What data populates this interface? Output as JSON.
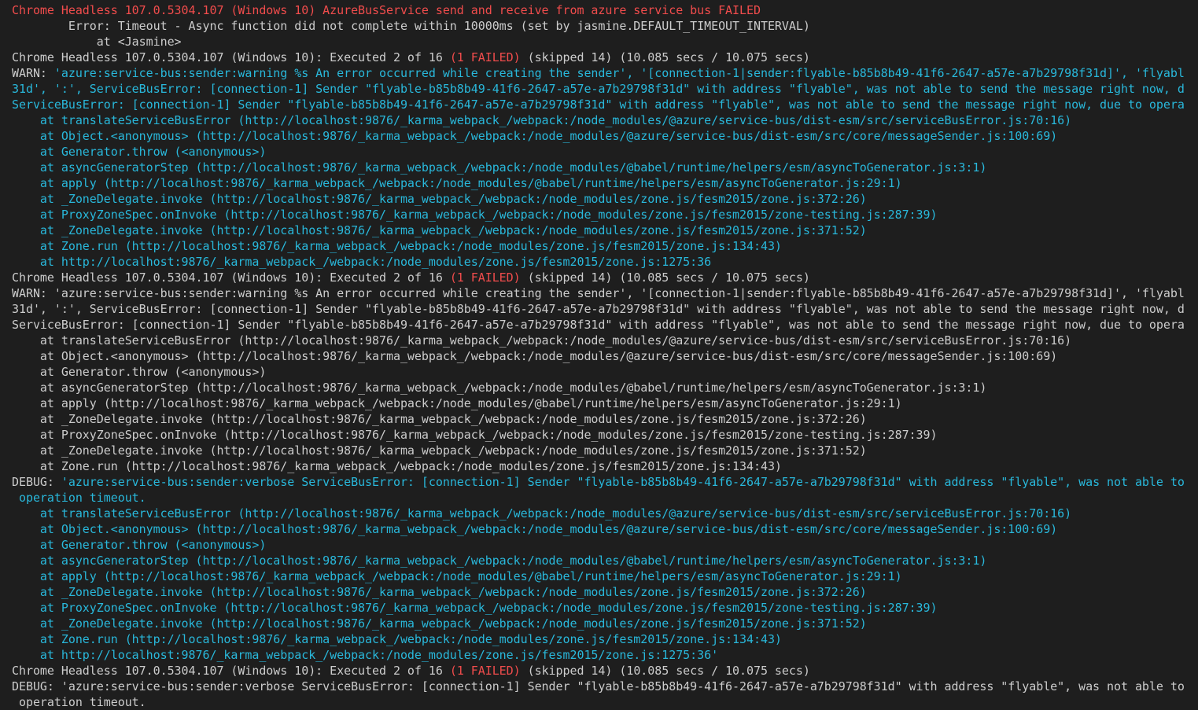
{
  "colors": {
    "background": "#1e1e1e",
    "default": "#cccccc",
    "red": "#f14c4c",
    "blue": "#29b8db"
  },
  "terminal": {
    "lines": [
      {
        "segments": [
          {
            "text": "Chrome Headless 107.0.5304.107 (Windows 10) AzureBusService send and receive from azure service bus FAILED",
            "color": "red"
          }
        ]
      },
      {
        "segments": [
          {
            "text": "        Error: Timeout - Async function did not complete within 10000ms (set by jasmine.DEFAULT_TIMEOUT_INTERVAL)",
            "color": "default"
          }
        ]
      },
      {
        "segments": [
          {
            "text": "            at <Jasmine>",
            "color": "default"
          }
        ]
      },
      {
        "segments": [
          {
            "text": "Chrome Headless 107.0.5304.107 (Windows 10): Executed 2 of 16 ",
            "color": "default"
          },
          {
            "text": "(1 FAILED)",
            "color": "red"
          },
          {
            "text": " (skipped 14) (10.085 secs / 10.075 secs)",
            "color": "default"
          }
        ]
      },
      {
        "segments": [
          {
            "text": "WARN: ",
            "color": "default"
          },
          {
            "text": "'azure:service-bus:sender:warning %s An error occurred while creating the sender', '[connection-1|sender:flyable-b85b8b49-41f6-2647-a57e-a7b29798f31d]', 'flyabl",
            "color": "blue"
          }
        ]
      },
      {
        "segments": [
          {
            "text": "31d', ':', ServiceBusError: [connection-1] Sender \"flyable-b85b8b49-41f6-2647-a57e-a7b29798f31d\" with address \"flyable\", was not able to send the message right now, d",
            "color": "blue"
          }
        ]
      },
      {
        "segments": [
          {
            "text": "ServiceBusError: [connection-1] Sender \"flyable-b85b8b49-41f6-2647-a57e-a7b29798f31d\" with address \"flyable\", was not able to send the message right now, due to opera",
            "color": "blue"
          }
        ]
      },
      {
        "segments": [
          {
            "text": "    at translateServiceBusError (http://localhost:9876/_karma_webpack_/webpack:/node_modules/@azure/service-bus/dist-esm/src/serviceBusError.js:70:16)",
            "color": "blue"
          }
        ]
      },
      {
        "segments": [
          {
            "text": "    at Object.<anonymous> (http://localhost:9876/_karma_webpack_/webpack:/node_modules/@azure/service-bus/dist-esm/src/core/messageSender.js:100:69)",
            "color": "blue"
          }
        ]
      },
      {
        "segments": [
          {
            "text": "    at Generator.throw (<anonymous>)",
            "color": "blue"
          }
        ]
      },
      {
        "segments": [
          {
            "text": "    at asyncGeneratorStep (http://localhost:9876/_karma_webpack_/webpack:/node_modules/@babel/runtime/helpers/esm/asyncToGenerator.js:3:1)",
            "color": "blue"
          }
        ]
      },
      {
        "segments": [
          {
            "text": "    at apply (http://localhost:9876/_karma_webpack_/webpack:/node_modules/@babel/runtime/helpers/esm/asyncToGenerator.js:29:1)",
            "color": "blue"
          }
        ]
      },
      {
        "segments": [
          {
            "text": "    at _ZoneDelegate.invoke (http://localhost:9876/_karma_webpack_/webpack:/node_modules/zone.js/fesm2015/zone.js:372:26)",
            "color": "blue"
          }
        ]
      },
      {
        "segments": [
          {
            "text": "    at ProxyZoneSpec.onInvoke (http://localhost:9876/_karma_webpack_/webpack:/node_modules/zone.js/fesm2015/zone-testing.js:287:39)",
            "color": "blue"
          }
        ]
      },
      {
        "segments": [
          {
            "text": "    at _ZoneDelegate.invoke (http://localhost:9876/_karma_webpack_/webpack:/node_modules/zone.js/fesm2015/zone.js:371:52)",
            "color": "blue"
          }
        ]
      },
      {
        "segments": [
          {
            "text": "    at Zone.run (http://localhost:9876/_karma_webpack_/webpack:/node_modules/zone.js/fesm2015/zone.js:134:43)",
            "color": "blue"
          }
        ]
      },
      {
        "segments": [
          {
            "text": "    at http://localhost:9876/_karma_webpack_/webpack:/node_modules/zone.js/fesm2015/zone.js:1275:36",
            "color": "blue"
          }
        ]
      },
      {
        "segments": [
          {
            "text": "Chrome Headless 107.0.5304.107 (Windows 10): Executed 2 of 16 ",
            "color": "default"
          },
          {
            "text": "(1 FAILED)",
            "color": "red"
          },
          {
            "text": " (skipped 14) (10.085 secs / 10.075 secs)",
            "color": "default"
          }
        ]
      },
      {
        "segments": [
          {
            "text": "WARN: 'azure:service-bus:sender:warning %s An error occurred while creating the sender', '[connection-1|sender:flyable-b85b8b49-41f6-2647-a57e-a7b29798f31d]', 'flyabl",
            "color": "default"
          }
        ]
      },
      {
        "segments": [
          {
            "text": "31d', ':', ServiceBusError: [connection-1] Sender \"flyable-b85b8b49-41f6-2647-a57e-a7b29798f31d\" with address \"flyable\", was not able to send the message right now, d",
            "color": "default"
          }
        ]
      },
      {
        "segments": [
          {
            "text": "ServiceBusError: [connection-1] Sender \"flyable-b85b8b49-41f6-2647-a57e-a7b29798f31d\" with address \"flyable\", was not able to send the message right now, due to opera",
            "color": "default"
          }
        ]
      },
      {
        "segments": [
          {
            "text": "    at translateServiceBusError (http://localhost:9876/_karma_webpack_/webpack:/node_modules/@azure/service-bus/dist-esm/src/serviceBusError.js:70:16)",
            "color": "default"
          }
        ]
      },
      {
        "segments": [
          {
            "text": "    at Object.<anonymous> (http://localhost:9876/_karma_webpack_/webpack:/node_modules/@azure/service-bus/dist-esm/src/core/messageSender.js:100:69)",
            "color": "default"
          }
        ]
      },
      {
        "segments": [
          {
            "text": "    at Generator.throw (<anonymous>)",
            "color": "default"
          }
        ]
      },
      {
        "segments": [
          {
            "text": "    at asyncGeneratorStep (http://localhost:9876/_karma_webpack_/webpack:/node_modules/@babel/runtime/helpers/esm/asyncToGenerator.js:3:1)",
            "color": "default"
          }
        ]
      },
      {
        "segments": [
          {
            "text": "    at apply (http://localhost:9876/_karma_webpack_/webpack:/node_modules/@babel/runtime/helpers/esm/asyncToGenerator.js:29:1)",
            "color": "default"
          }
        ]
      },
      {
        "segments": [
          {
            "text": "    at _ZoneDelegate.invoke (http://localhost:9876/_karma_webpack_/webpack:/node_modules/zone.js/fesm2015/zone.js:372:26)",
            "color": "default"
          }
        ]
      },
      {
        "segments": [
          {
            "text": "    at ProxyZoneSpec.onInvoke (http://localhost:9876/_karma_webpack_/webpack:/node_modules/zone.js/fesm2015/zone-testing.js:287:39)",
            "color": "default"
          }
        ]
      },
      {
        "segments": [
          {
            "text": "    at _ZoneDelegate.invoke (http://localhost:9876/_karma_webpack_/webpack:/node_modules/zone.js/fesm2015/zone.js:371:52)",
            "color": "default"
          }
        ]
      },
      {
        "segments": [
          {
            "text": "    at Zone.run (http://localhost:9876/_karma_webpack_/webpack:/node_modules/zone.js/fesm2015/zone.js:134:43)",
            "color": "default"
          }
        ]
      },
      {
        "segments": [
          {
            "text": "DEBUG: ",
            "color": "default"
          },
          {
            "text": "'azure:service-bus:sender:verbose ServiceBusError: [connection-1] Sender \"flyable-b85b8b49-41f6-2647-a57e-a7b29798f31d\" with address \"flyable\", was not able to",
            "color": "blue"
          }
        ]
      },
      {
        "segments": [
          {
            "text": " operation timeout.",
            "color": "blue"
          }
        ]
      },
      {
        "segments": [
          {
            "text": "    at translateServiceBusError (http://localhost:9876/_karma_webpack_/webpack:/node_modules/@azure/service-bus/dist-esm/src/serviceBusError.js:70:16)",
            "color": "blue"
          }
        ]
      },
      {
        "segments": [
          {
            "text": "    at Object.<anonymous> (http://localhost:9876/_karma_webpack_/webpack:/node_modules/@azure/service-bus/dist-esm/src/core/messageSender.js:100:69)",
            "color": "blue"
          }
        ]
      },
      {
        "segments": [
          {
            "text": "    at Generator.throw (<anonymous>)",
            "color": "blue"
          }
        ]
      },
      {
        "segments": [
          {
            "text": "    at asyncGeneratorStep (http://localhost:9876/_karma_webpack_/webpack:/node_modules/@babel/runtime/helpers/esm/asyncToGenerator.js:3:1)",
            "color": "blue"
          }
        ]
      },
      {
        "segments": [
          {
            "text": "    at apply (http://localhost:9876/_karma_webpack_/webpack:/node_modules/@babel/runtime/helpers/esm/asyncToGenerator.js:29:1)",
            "color": "blue"
          }
        ]
      },
      {
        "segments": [
          {
            "text": "    at _ZoneDelegate.invoke (http://localhost:9876/_karma_webpack_/webpack:/node_modules/zone.js/fesm2015/zone.js:372:26)",
            "color": "blue"
          }
        ]
      },
      {
        "segments": [
          {
            "text": "    at ProxyZoneSpec.onInvoke (http://localhost:9876/_karma_webpack_/webpack:/node_modules/zone.js/fesm2015/zone-testing.js:287:39)",
            "color": "blue"
          }
        ]
      },
      {
        "segments": [
          {
            "text": "    at _ZoneDelegate.invoke (http://localhost:9876/_karma_webpack_/webpack:/node_modules/zone.js/fesm2015/zone.js:371:52)",
            "color": "blue"
          }
        ]
      },
      {
        "segments": [
          {
            "text": "    at Zone.run (http://localhost:9876/_karma_webpack_/webpack:/node_modules/zone.js/fesm2015/zone.js:134:43)",
            "color": "blue"
          }
        ]
      },
      {
        "segments": [
          {
            "text": "    at http://localhost:9876/_karma_webpack_/webpack:/node_modules/zone.js/fesm2015/zone.js:1275:36'",
            "color": "blue"
          }
        ]
      },
      {
        "segments": [
          {
            "text": "Chrome Headless 107.0.5304.107 (Windows 10): Executed 2 of 16 ",
            "color": "default"
          },
          {
            "text": "(1 FAILED)",
            "color": "red"
          },
          {
            "text": " (skipped 14) (10.085 secs / 10.075 secs)",
            "color": "default"
          }
        ]
      },
      {
        "segments": [
          {
            "text": "DEBUG: 'azure:service-bus:sender:verbose ServiceBusError: [connection-1] Sender \"flyable-b85b8b49-41f6-2647-a57e-a7b29798f31d\" with address \"flyable\", was not able to",
            "color": "default"
          }
        ]
      },
      {
        "segments": [
          {
            "text": " operation timeout.",
            "color": "default"
          }
        ]
      }
    ]
  }
}
